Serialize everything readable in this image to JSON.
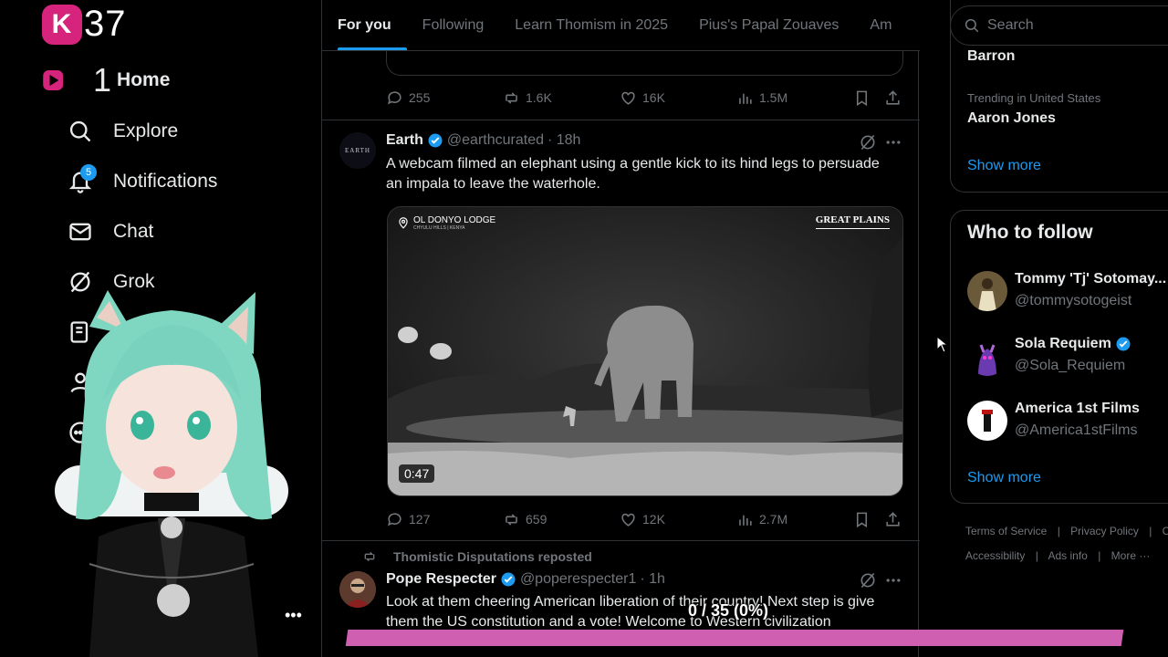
{
  "brand": {
    "text": "37",
    "nav_num": "1"
  },
  "nav": {
    "home": "Home",
    "explore": "Explore",
    "notifications": "Notifications",
    "notifications_badge": "5",
    "chat": "Chat",
    "grok": "Grok"
  },
  "tabs": [
    "For you",
    "Following",
    "Learn Thomism in 2025",
    "Pius's Papal Zouaves",
    "Am"
  ],
  "tweet1": {
    "replies": "255",
    "reposts": "1.6K",
    "likes": "16K",
    "views": "1.5M"
  },
  "tweet2": {
    "avatar_text": "EARTH",
    "name": "Earth",
    "handle": "@earthcurated",
    "time": "· 18h",
    "text": "A webcam filmed an elephant using a gentle kick to its hind legs to persuade an impala to leave the waterhole.",
    "media": {
      "location": "OL DONYO LODGE",
      "location_sub": "CHYULU HILLS | KENYA",
      "watermark": "GREAT PLAINS",
      "duration": "0:47"
    },
    "replies": "127",
    "reposts": "659",
    "likes": "12K",
    "views": "2.7M"
  },
  "tweet3": {
    "repost_label": "Thomistic Disputations reposted",
    "name": "Pope Respecter",
    "handle": "@poperespecter1",
    "time": "· 1h",
    "text": "Look at them cheering American liberation of their country! Next step is give them the US constitution and a vote! Welcome to Western civilization"
  },
  "search": {
    "placeholder": "Search"
  },
  "trends": [
    {
      "name": "Barron"
    },
    {
      "label": "Trending in United States",
      "name": "Aaron Jones"
    }
  ],
  "trends_show_more": "Show more",
  "who_to_follow": {
    "title": "Who to follow",
    "accounts": [
      {
        "name": "Tommy 'Tj' Sotomay...",
        "handle": "@tommysotogeist"
      },
      {
        "name": "Sola Requiem",
        "handle": "@Sola_Requiem"
      },
      {
        "name": "America 1st Films",
        "handle": "@America1stFilms"
      }
    ],
    "show_more": "Show more"
  },
  "footer": {
    "terms": "Terms of Service",
    "privacy": "Privacy Policy",
    "c": "C",
    "accessibility": "Accessibility",
    "ads": "Ads info",
    "more": "More ···"
  },
  "overlay": {
    "progress_text": "0 / 35 (0%)",
    "progress": 0
  },
  "colors": {
    "accent": "#1d9bf0",
    "brand_pink": "#d6247c",
    "progress": "#cf5fb1"
  }
}
